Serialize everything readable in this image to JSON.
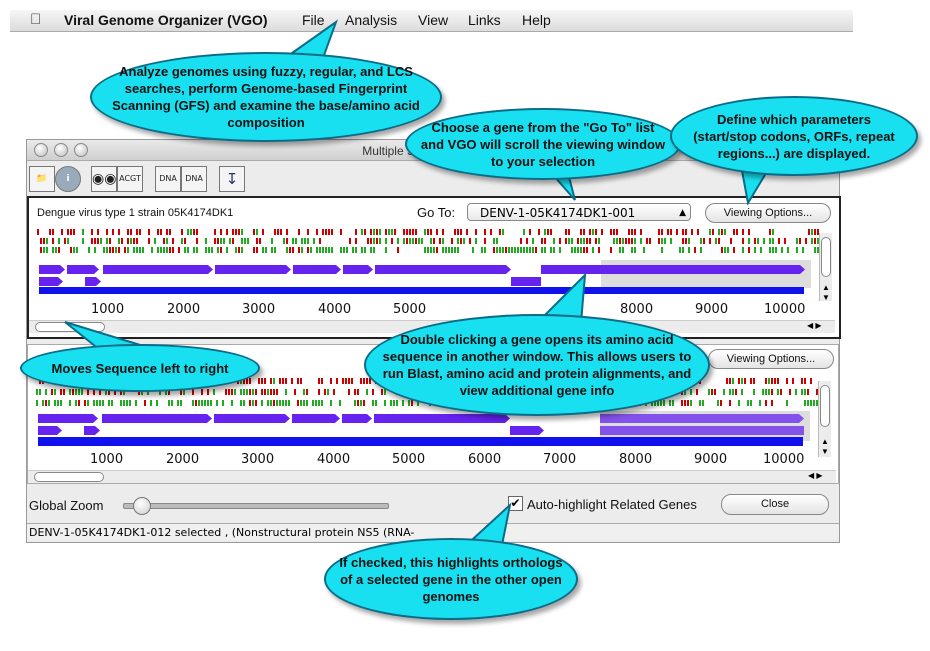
{
  "menubar": {
    "app_name": "Viral Genome Organizer (VGO)",
    "menus": [
      "File",
      "Analysis",
      "View",
      "Links",
      "Help"
    ]
  },
  "window": {
    "title": "Multiple Sequence Display",
    "toolbar_icons": [
      "open-folder-icon",
      "info-icon",
      "binoculars-icon",
      "fasta-icon",
      "dna-icon",
      "dna-export-icon",
      "download-icon"
    ],
    "toolbar_texts": {
      "fasta": "ACGT",
      "dna1": "DNA",
      "dna2": "DNA"
    }
  },
  "panel1": {
    "genome_title": "Dengue virus type 1 strain 05K4174DK1",
    "goto_label": "Go To:",
    "goto_value": "DENV-1-05K4174DK1-001",
    "viewing_options": "Viewing Options...",
    "axis_ticks": [
      "1000",
      "2000",
      "3000",
      "4000",
      "5000",
      "8000",
      "9000",
      "10000"
    ]
  },
  "panel2": {
    "viewing_options": "Viewing Options...",
    "axis_ticks": [
      "1000",
      "2000",
      "3000",
      "4000",
      "5000",
      "6000",
      "7000",
      "8000",
      "9000",
      "10000"
    ]
  },
  "bottom": {
    "zoom_label": "Global Zoom",
    "zoom_value": 0.04,
    "checkbox_label": "Auto-highlight Related Genes",
    "checkbox_checked": true,
    "close_label": "Close"
  },
  "status": "DENV-1-05K4174DK1-012 selected , (Nonstructural protein NS5 (RNA-",
  "callouts": {
    "analyze": "Analyze genomes using fuzzy, regular, and LCS searches, perform Genome-based Fingerprint Scanning (GFS) and examine the base/amino acid composition",
    "goto": "Choose a gene from the \"Go To\" list and VGO will scroll the viewing window to your selection",
    "define": "Define which parameters (start/stop codons, ORFs, repeat regions...) are displayed.",
    "double": "Double clicking a gene opens its amino acid sequence in another window. This allows users to run Blast, amino acid and protein alignments, and view additional gene info",
    "moves": "Moves Sequence left to right",
    "checked": "If checked, this highlights orthologs of a selected gene in the other open genomes"
  },
  "colors": {
    "gene": "#6622ee",
    "callout": "#19e0f0",
    "stop_codon": "#cc0000",
    "start_codon": "#22aa22"
  }
}
